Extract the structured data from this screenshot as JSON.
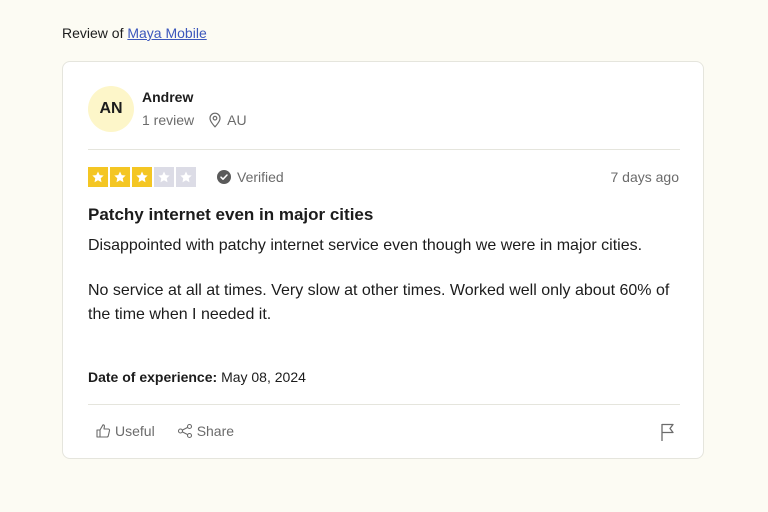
{
  "header": {
    "prefix": "Review of",
    "company_link": "Maya Mobile"
  },
  "reviewer": {
    "initials": "AN",
    "name": "Andrew",
    "review_count": "1 review",
    "country": "AU"
  },
  "rating": {
    "stars": 3,
    "max_stars": 5,
    "verified_label": "Verified",
    "posted_ago": "7 days ago"
  },
  "review": {
    "title": "Patchy internet even in major cities",
    "paragraphs": [
      "Disappointed with patchy internet service even though we were in major cities.",
      "No service at all at times. Very slow at other times. Worked well only about 60% of the time when I needed it."
    ],
    "experience_label": "Date of experience:",
    "experience_date": "May 08, 2024"
  },
  "actions": {
    "useful_label": "Useful",
    "share_label": "Share"
  },
  "colors": {
    "star_filled": "#f4c623",
    "star_empty": "#dcdce6",
    "link": "#3c57bc",
    "avatar_bg": "#fdf6c9"
  }
}
